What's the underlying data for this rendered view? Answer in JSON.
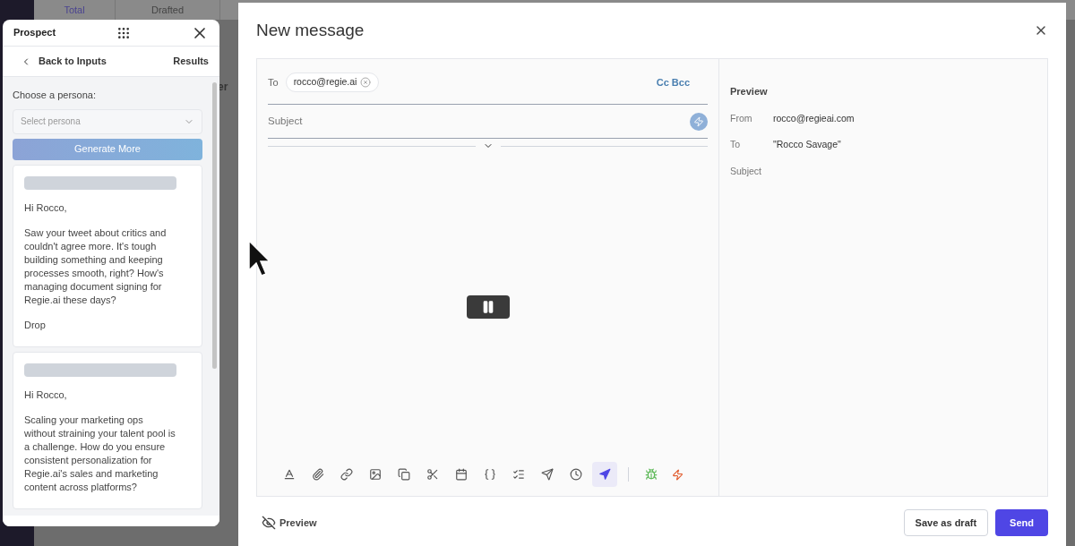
{
  "background": {
    "columns": [
      "Total",
      "Drafted"
    ],
    "partial_text": "er"
  },
  "prospect": {
    "title": "Prospect",
    "back": "Back to Inputs",
    "results": "Results",
    "persona_label": "Choose a persona:",
    "persona_placeholder": "Select persona",
    "generate": "Generate More",
    "drafts": [
      {
        "greeting": "Hi Rocco,",
        "body": "Saw your tweet about critics and couldn't agree more. It's tough building something and keeping processes smooth, right? How's managing document signing for Regie.ai these days?",
        "sign": "Drop"
      },
      {
        "greeting": "Hi Rocco,",
        "body": "Scaling your marketing ops without straining your talent pool is a challenge. How do you ensure consistent personalization for Regie.ai's sales and marketing content across platforms?"
      }
    ]
  },
  "message": {
    "title": "New message",
    "to_label": "To",
    "recipient": "rocco@regie.ai",
    "cc_bcc": "Cc Bcc",
    "subject_placeholder": "Subject",
    "tools": [
      {
        "selected": false
      },
      {
        "selected": false
      },
      {
        "selected": false
      },
      {
        "selected": false
      },
      {
        "selected": false
      },
      {
        "selected": false
      },
      {
        "selected": false
      },
      {
        "selected": false
      },
      {
        "selected": false
      },
      {
        "selected": false
      },
      {
        "selected": false
      },
      {
        "selected": true
      }
    ],
    "preview": {
      "title": "Preview",
      "rows": [
        {
          "label": "From",
          "value": "rocco@regieai.com"
        },
        {
          "label": "To",
          "value": "\"Rocco Savage\""
        },
        {
          "label": "Subject"
        }
      ]
    },
    "preview_toggle": "Preview",
    "save": "Save as draft",
    "send": "Send"
  }
}
